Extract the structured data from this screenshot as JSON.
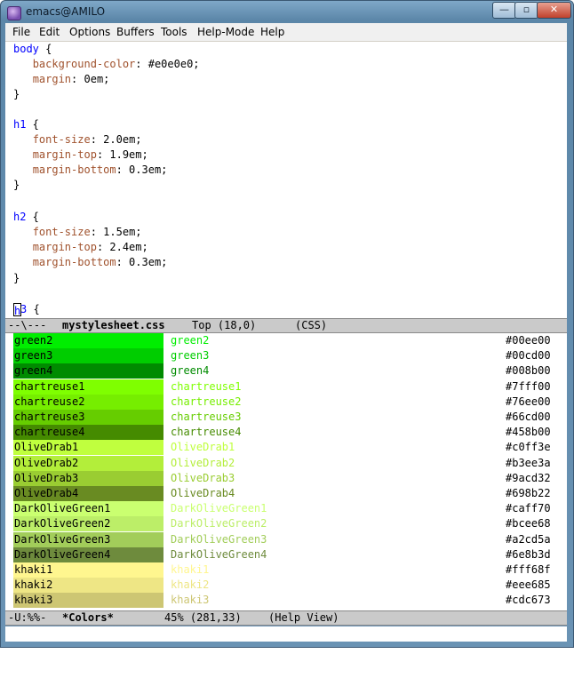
{
  "window": {
    "title": "emacs@AMILO"
  },
  "window_buttons": {
    "minimize": "—",
    "maximize": "▫",
    "close": "✕"
  },
  "menubar": [
    "File",
    "Edit",
    "Options",
    "Buffers",
    "Tools",
    "Help-Mode",
    "Help"
  ],
  "editor": {
    "lines": [
      {
        "sel": "body",
        "rest": " {"
      },
      {
        "prop": "background-color",
        "rest": ": #e0e0e0;"
      },
      {
        "prop": "margin",
        "rest": ": 0em;"
      },
      {
        "plain": "}"
      },
      {
        "plain": ""
      },
      {
        "sel": "h1",
        "rest": " {"
      },
      {
        "prop": "font-size",
        "rest": ": 2.0em;"
      },
      {
        "prop": "margin-top",
        "rest": ": 1.9em;"
      },
      {
        "prop": "margin-bottom",
        "rest": ": 0.3em;"
      },
      {
        "plain": "}"
      },
      {
        "plain": ""
      },
      {
        "sel": "h2",
        "rest": " {"
      },
      {
        "prop": "font-size",
        "rest": ": 1.5em;"
      },
      {
        "prop": "margin-top",
        "rest": ": 2.4em;"
      },
      {
        "prop": "margin-bottom",
        "rest": ": 0.3em;"
      },
      {
        "plain": "}"
      },
      {
        "plain": ""
      },
      {
        "cursor_char": "h",
        "sel": "3",
        "rest": " {"
      }
    ]
  },
  "modeline_top": {
    "status": "--\\---",
    "buffer": "mystylesheet.css",
    "position": "Top (18,0)",
    "mode": "(CSS)"
  },
  "colors": [
    {
      "name": "green2",
      "hex": "#00ee00"
    },
    {
      "name": "green3",
      "hex": "#00cd00"
    },
    {
      "name": "green4",
      "hex": "#008b00"
    },
    {
      "name": "chartreuse1",
      "hex": "#7fff00"
    },
    {
      "name": "chartreuse2",
      "hex": "#76ee00"
    },
    {
      "name": "chartreuse3",
      "hex": "#66cd00"
    },
    {
      "name": "chartreuse4",
      "hex": "#458b00"
    },
    {
      "name": "OliveDrab1",
      "hex": "#c0ff3e"
    },
    {
      "name": "OliveDrab2",
      "hex": "#b3ee3a"
    },
    {
      "name": "OliveDrab3",
      "hex": "#9acd32"
    },
    {
      "name": "OliveDrab4",
      "hex": "#698b22"
    },
    {
      "name": "DarkOliveGreen1",
      "hex": "#caff70"
    },
    {
      "name": "DarkOliveGreen2",
      "hex": "#bcee68"
    },
    {
      "name": "DarkOliveGreen3",
      "hex": "#a2cd5a"
    },
    {
      "name": "DarkOliveGreen4",
      "hex": "#6e8b3d"
    },
    {
      "name": "khaki1",
      "hex": "#fff68f"
    },
    {
      "name": "khaki2",
      "hex": "#eee685"
    },
    {
      "name": "khaki3",
      "hex": "#cdc673"
    }
  ],
  "modeline_bottom": {
    "status": "-U:%%-",
    "buffer": "*Colors*",
    "position": "45% (281,33)",
    "mode": "(Help View)"
  },
  "minibuffer": {
    "text": ""
  }
}
